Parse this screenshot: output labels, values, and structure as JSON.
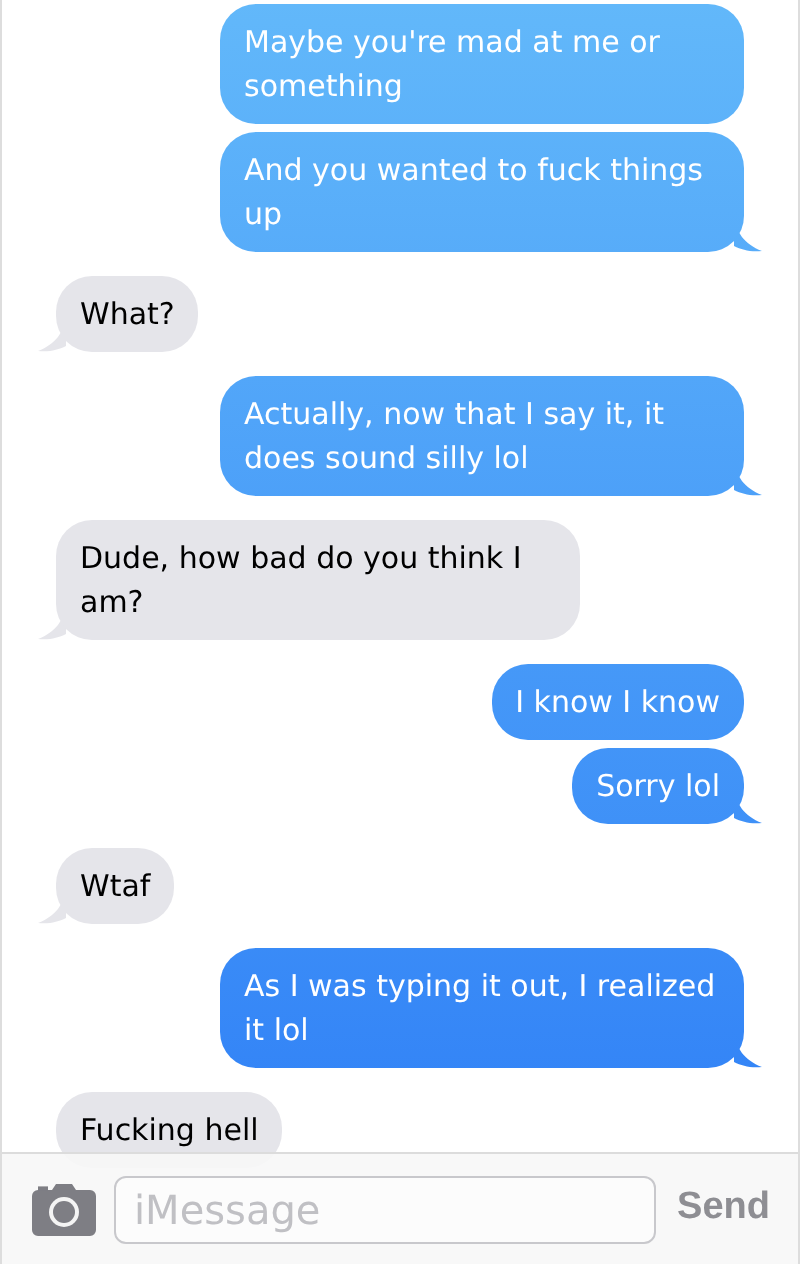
{
  "messages": [
    {
      "kind": "me",
      "text": "Maybe you're mad at me or something",
      "tail": false
    },
    {
      "kind": "me",
      "text": "And you wanted to fuck things up",
      "tail": true
    },
    {
      "kind": "them",
      "text": "What?",
      "tail": true
    },
    {
      "kind": "me",
      "text": "Actually, now that I say it, it does sound silly lol",
      "tail": true
    },
    {
      "kind": "them",
      "text": "Dude, how bad do you think I am?",
      "tail": true
    },
    {
      "kind": "me",
      "text": "I know I know",
      "tail": false
    },
    {
      "kind": "me",
      "text": "Sorry lol",
      "tail": true
    },
    {
      "kind": "them",
      "text": "Wtaf",
      "tail": true
    },
    {
      "kind": "me",
      "text": "As I was typing it out, I realized it lol",
      "tail": true
    },
    {
      "kind": "them",
      "text": "Fucking hell",
      "tail": false
    }
  ],
  "composer": {
    "placeholder": "iMessage",
    "send_label": "Send"
  }
}
